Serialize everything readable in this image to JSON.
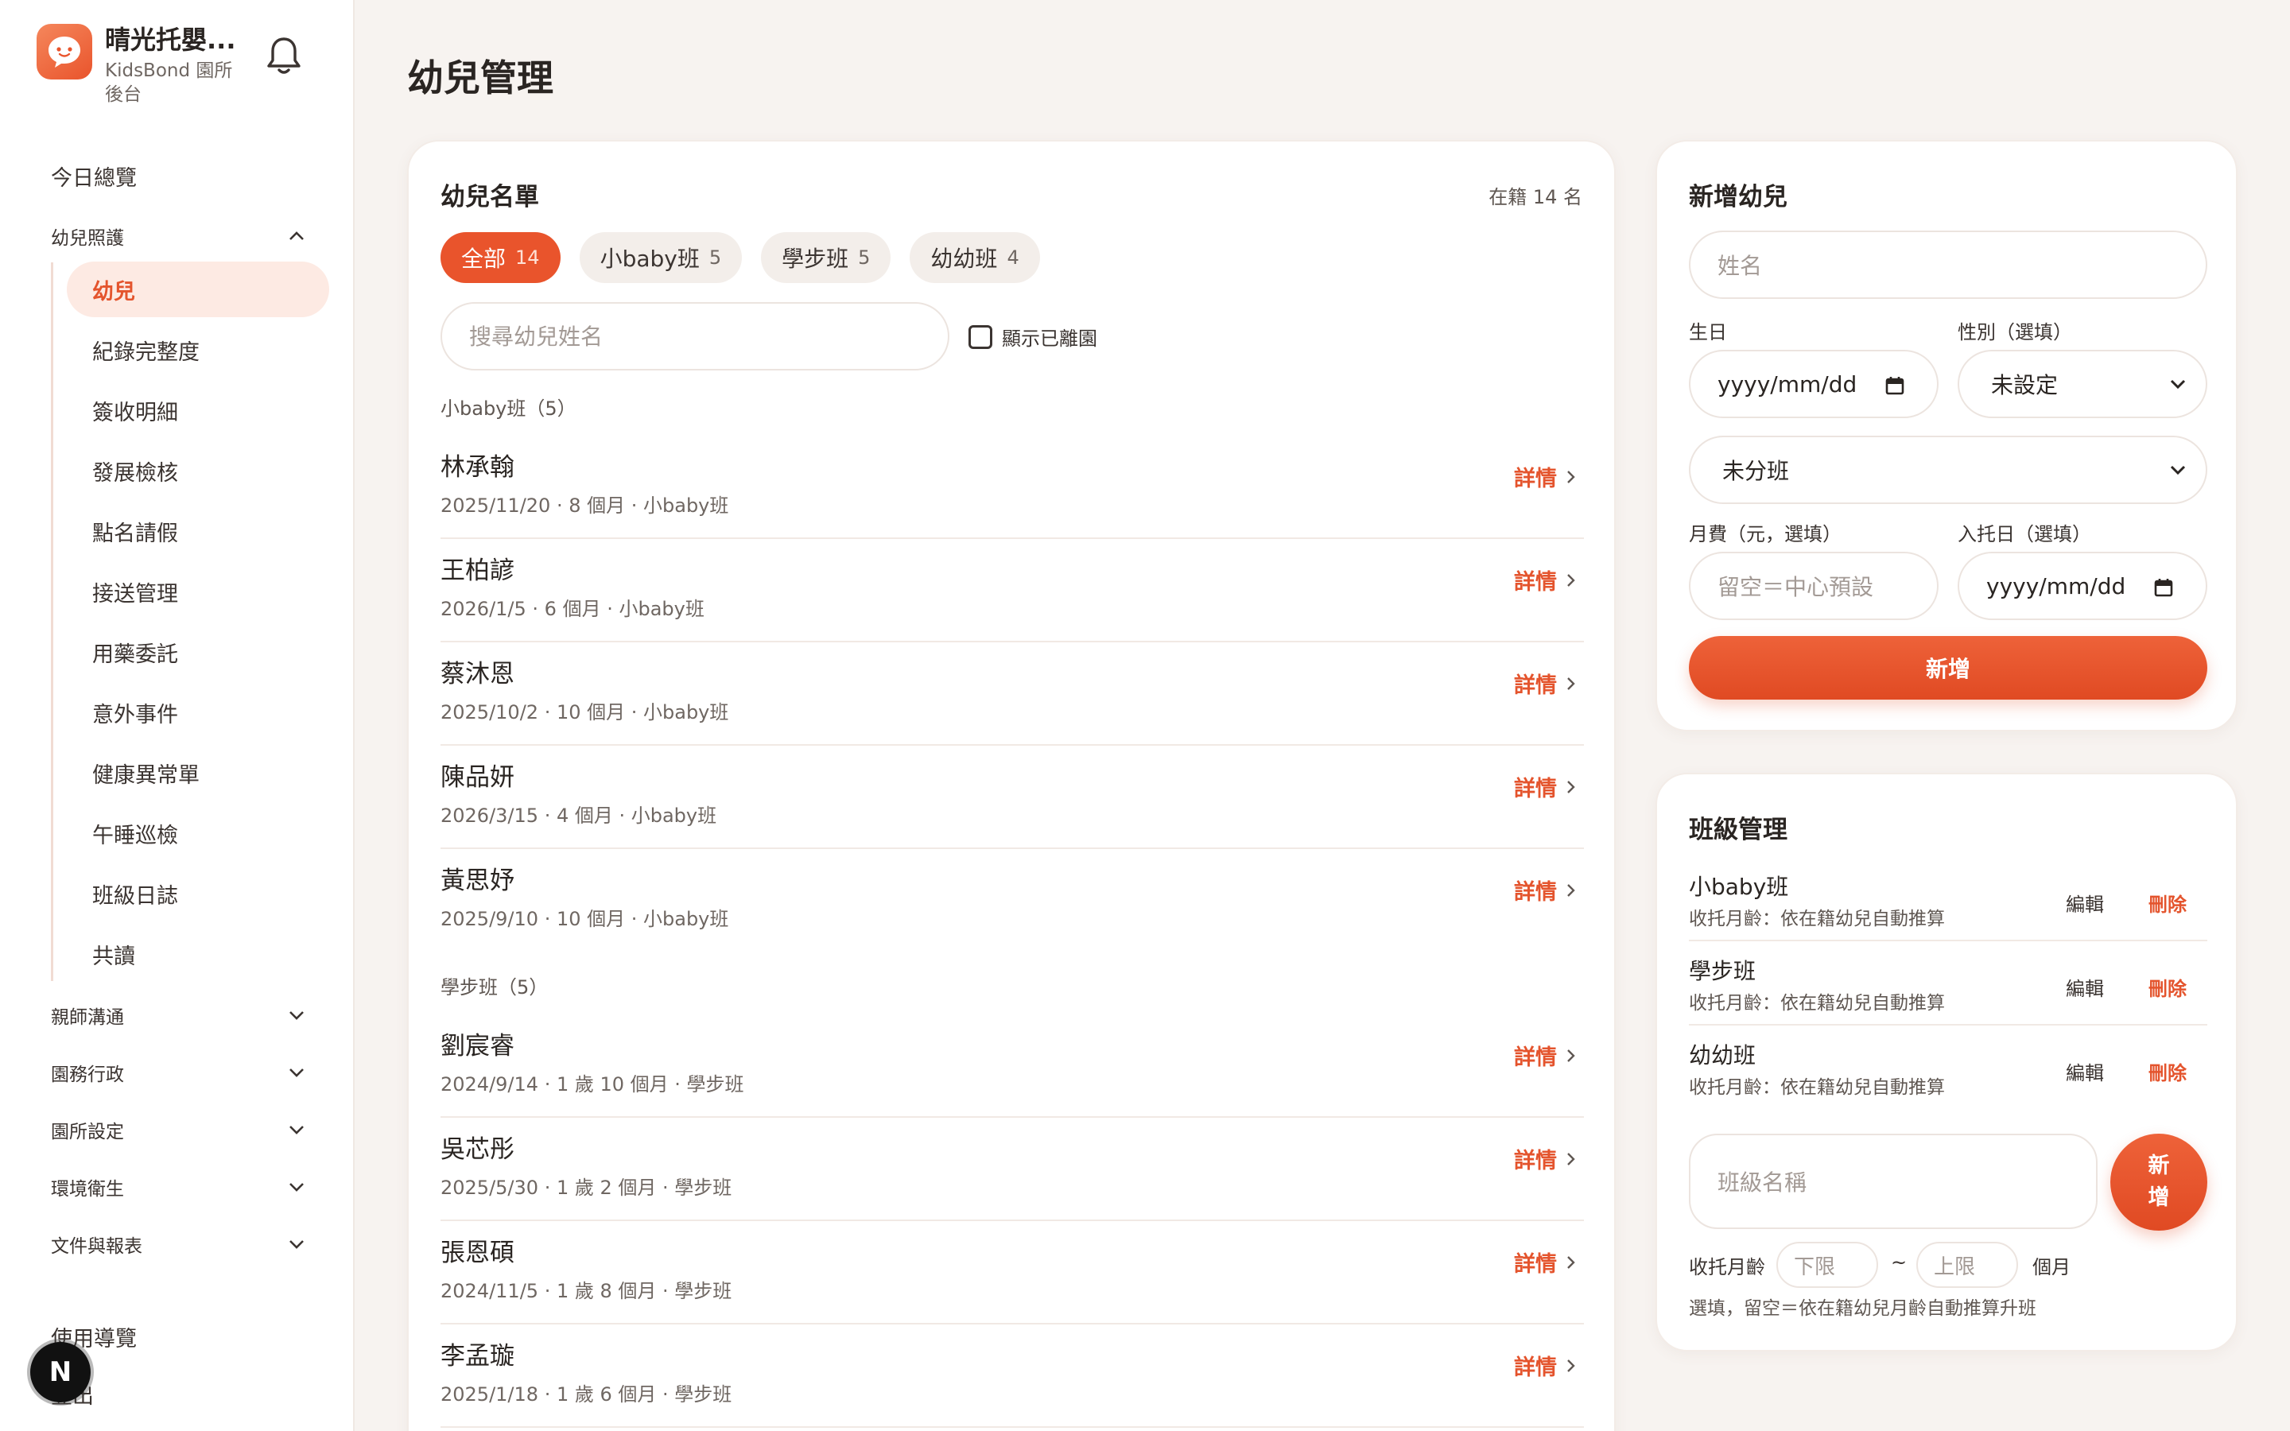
{
  "brand": {
    "name": "晴光托嬰...",
    "subtitle": "KidsBond 園所後台"
  },
  "sidebar": {
    "overview": "今日總覽",
    "care_group": "幼兒照護",
    "care_items": [
      "幼兒",
      "紀錄完整度",
      "簽收明細",
      "發展檢核",
      "點名請假",
      "接送管理",
      "用藥委託",
      "意外事件",
      "健康異常單",
      "午睡巡檢",
      "班級日誌",
      "共讀"
    ],
    "groups": [
      "親師溝通",
      "園務行政",
      "園所設定",
      "環境衛生",
      "文件與報表"
    ],
    "help": "使用導覽",
    "logout": "登出",
    "avatar_letter": "N"
  },
  "page": {
    "title": "幼兒管理"
  },
  "list": {
    "title": "幼兒名單",
    "enrolled": "在籍 14 名",
    "chips": [
      {
        "label": "全部",
        "count": "14"
      },
      {
        "label": "小baby班",
        "count": "5"
      },
      {
        "label": "學步班",
        "count": "5"
      },
      {
        "label": "幼幼班",
        "count": "4"
      }
    ],
    "search_placeholder": "搜尋幼兒姓名",
    "show_left_label": "顯示已離園",
    "detail_label": "詳情",
    "sections": [
      {
        "label": "小baby班（5）",
        "rows": [
          {
            "name": "林承翰",
            "meta": "2025/11/20 · 8 個月 · 小baby班"
          },
          {
            "name": "王柏諺",
            "meta": "2026/1/5 · 6 個月 · 小baby班"
          },
          {
            "name": "蔡沐恩",
            "meta": "2025/10/2 · 10 個月 · 小baby班"
          },
          {
            "name": "陳品妍",
            "meta": "2026/3/15 · 4 個月 · 小baby班"
          },
          {
            "name": "黃思妤",
            "meta": "2025/9/10 · 10 個月 · 小baby班"
          }
        ]
      },
      {
        "label": "學步班（5）",
        "rows": [
          {
            "name": "劉宸睿",
            "meta": "2024/9/14 · 1 歲 10 個月 · 學步班"
          },
          {
            "name": "吳芯彤",
            "meta": "2025/5/30 · 1 歲 2 個月 · 學步班"
          },
          {
            "name": "張恩碩",
            "meta": "2024/11/5 · 1 歲 8 個月 · 學步班"
          },
          {
            "name": "李孟璇",
            "meta": "2025/1/18 · 1 歲 6 個月 · 學步班"
          }
        ]
      }
    ]
  },
  "add_child": {
    "title": "新增幼兒",
    "name_placeholder": "姓名",
    "birthday_label": "生日",
    "birthday_value": "yyyy/mm/dd",
    "gender_label": "性別（選填）",
    "gender_value": "未設定",
    "class_value": "未分班",
    "fee_label": "月費（元，選填）",
    "fee_placeholder": "留空＝中心預設",
    "enroll_label": "入托日（選填）",
    "enroll_value": "yyyy/mm/dd",
    "submit": "新增"
  },
  "class_mgmt": {
    "title": "班級管理",
    "edit_label": "編輯",
    "delete_label": "刪除",
    "classes": [
      {
        "name": "小baby班",
        "desc": "收托月齡：依在籍幼兒自動推算"
      },
      {
        "name": "學步班",
        "desc": "收托月齡：依在籍幼兒自動推算"
      },
      {
        "name": "幼幼班",
        "desc": "收托月齡：依在籍幼兒自動推算"
      }
    ],
    "name_placeholder": "班級名稱",
    "add_button": "新增",
    "range_label": "收托月齡",
    "lower_placeholder": "下限",
    "tilde": "~",
    "upper_placeholder": "上限",
    "unit": "個月",
    "hint": "選填，留空＝依在籍幼兒月齡自動推算升班"
  },
  "colors": {
    "accent": "#e9542c",
    "background": "#f7f3f0"
  }
}
